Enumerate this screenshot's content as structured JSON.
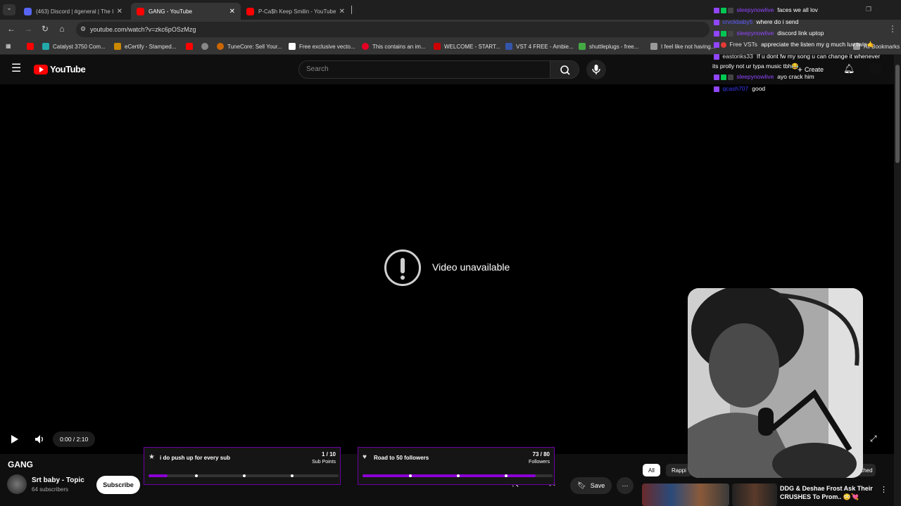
{
  "browser": {
    "tabs": [
      {
        "label": "(463) Discord | #general | The I",
        "color": "#5865F2"
      },
      {
        "label": "GANG - YouTube",
        "color": "#ff0000",
        "active": true
      },
      {
        "label": "P-Ca$h Keep Smilin - YouTube",
        "color": "#ff0000"
      }
    ],
    "url": "youtube.com/watch?v=zkc6pOSzMzg",
    "bookmarks": [
      {
        "label": "Catalyst 3750 Com...",
        "color": "#2aa"
      },
      {
        "label": "eCertify - Stamped...",
        "color": "#c80"
      },
      {
        "label": "TuneCore: Sell Your...",
        "color": "#c60"
      },
      {
        "label": "Free exclusive vecto...",
        "color": "#fff"
      },
      {
        "label": "This contains an im...",
        "color": "#e60023"
      },
      {
        "label": "WELCOME - START...",
        "color": "#c00"
      },
      {
        "label": "VST 4 FREE - Ambie...",
        "color": "#35a"
      },
      {
        "label": "shuttleplugs - free...",
        "color": "#4a4"
      },
      {
        "label": "I feel like not having...",
        "color": "#999"
      },
      {
        "label": "All Bookmarks",
        "color": "#999"
      }
    ]
  },
  "youtube": {
    "logo": "YouTube",
    "search_placeholder": "Search",
    "create_label": "Create",
    "unavailable_text": "Video unavailable",
    "time": "0:00 / 2:10",
    "video_title": "GANG",
    "channel_name": "Srt baby - Topic",
    "subscribers": "64 subscribers",
    "subscribe_label": "Subscribe",
    "save_label": "Save",
    "chips": [
      "All",
      "Rappi",
      "tched"
    ],
    "related_title_1": "DDG & Deshae Frost Ask Their",
    "related_title_2": "CRUSHES To Prom.. 😳💘"
  },
  "chat": [
    {
      "user": "sleepynowlive",
      "msg": "faces we all lov"
    },
    {
      "user": "crvckbaby5",
      "msg": "where do i send"
    },
    {
      "user": "sleepynowlive",
      "msg": "discord link uptop"
    },
    {
      "user": "Free VSTs",
      "msg": "appreciate the listen my g much luv twin🤙"
    },
    {
      "user": "eastonks33",
      "msg": "If u dont fw my song u can change it whenever"
    },
    {
      "user": "",
      "msg": "its prolly not ur typa music tbh😂"
    },
    {
      "user": "sleepynowlive",
      "msg": "ayo crack him"
    },
    {
      "user": "qcash707",
      "msg": "good"
    }
  ],
  "goals": [
    {
      "title": "i do push up for every sub",
      "count": "1 / 10",
      "unit": "Sub Points",
      "progress": 0.1
    },
    {
      "title": "Road to 50 followers",
      "count": "73 / 80",
      "unit": "Followers",
      "progress": 0.91
    }
  ],
  "colors": {
    "accent": "#8b00d4",
    "youtube_red": "#ff0000",
    "twitch_purple": "#9146ff"
  }
}
